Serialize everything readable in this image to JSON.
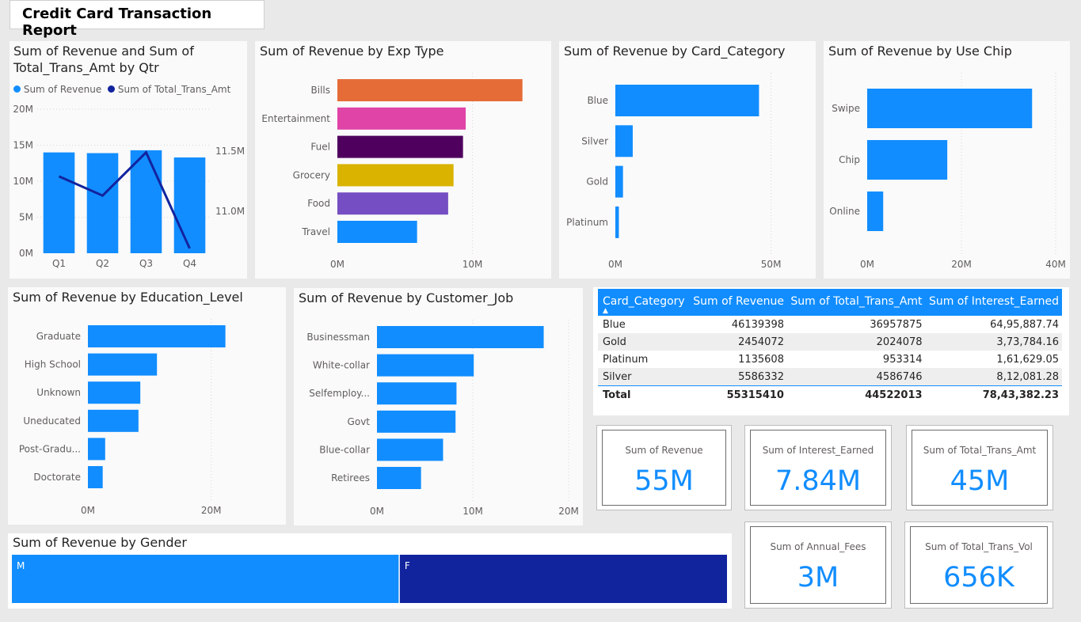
{
  "report": {
    "title": "Credit Card Transaction Report"
  },
  "colors": {
    "blue": "#118DFF",
    "navy": "#12239E",
    "orange": "#E66C37",
    "pink": "#E044A7",
    "purple": "#6B007B",
    "dark_purple": "#4F005E",
    "gold": "#D9B300",
    "violet": "#744EC2"
  },
  "qtr_chart": {
    "title_line1": "Sum of Revenue and Sum of",
    "title_line2": "Total_Trans_Amt by Qtr",
    "legend": [
      "Sum of Revenue",
      "Sum of Total_Trans_Amt"
    ]
  },
  "exp_chart": {
    "title": "Sum of Revenue by Exp Type"
  },
  "card_cat_chart": {
    "title": "Sum of Revenue by Card_Category"
  },
  "chip_chart": {
    "title": "Sum of Revenue by Use Chip"
  },
  "edu_chart": {
    "title": "Sum of Revenue by Education_Level"
  },
  "job_chart": {
    "title": "Sum of Revenue by Customer_Job"
  },
  "gender_chart": {
    "title": "Sum of Revenue by Gender"
  },
  "table": {
    "columns": [
      "Card_Category",
      "Sum of Revenue",
      "Sum of Total_Trans_Amt",
      "Sum of Interest_Earned"
    ],
    "rows": [
      [
        "Blue",
        "46139398",
        "36957875",
        "64,95,887.74"
      ],
      [
        "Gold",
        "2454072",
        "2024078",
        "3,73,784.16"
      ],
      [
        "Platinum",
        "1135608",
        "953314",
        "1,61,629.05"
      ],
      [
        "Silver",
        "5586332",
        "4586746",
        "8,12,081.28"
      ]
    ],
    "total": [
      "Total",
      "55315410",
      "44522013",
      "78,43,382.23"
    ]
  },
  "kpis": [
    {
      "label": "Sum of Revenue",
      "value": "55M"
    },
    {
      "label": "Sum of Interest_Earned",
      "value": "7.84M"
    },
    {
      "label": "Sum of Total_Trans_Amt",
      "value": "45M"
    },
    {
      "label": "Sum of Annual_Fees",
      "value": "3M"
    },
    {
      "label": "Sum of Total_Trans_Vol",
      "value": "656K"
    }
  ],
  "chart_data": [
    {
      "id": "qtr",
      "type": "bar",
      "title": "Sum of Revenue and Sum of Total_Trans_Amt by Qtr",
      "categories": [
        "Q1",
        "Q2",
        "Q3",
        "Q4"
      ],
      "series": [
        {
          "name": "Sum of Revenue",
          "type": "bar",
          "axis": "left",
          "values": [
            14000000,
            13900000,
            14300000,
            13300000
          ]
        },
        {
          "name": "Sum of Total_Trans_Amt",
          "type": "line",
          "axis": "right",
          "values": [
            11290000,
            11130000,
            11490000,
            10690000
          ]
        }
      ],
      "ylim": [
        0,
        20000000
      ],
      "yticks": [
        0,
        5000000,
        10000000,
        15000000,
        20000000
      ],
      "ytick_labels": [
        "0M",
        "5M",
        "10M",
        "15M",
        "20M"
      ],
      "y2lim": [
        10650000,
        11850000
      ],
      "y2ticks": [
        11000000,
        11500000
      ],
      "y2tick_labels": [
        "11.0M",
        "11.5M"
      ],
      "legend": "top-left"
    },
    {
      "id": "exp",
      "type": "bar",
      "orientation": "horizontal",
      "title": "Sum of Revenue by Exp Type",
      "categories": [
        "Bills",
        "Entertainment",
        "Fuel",
        "Grocery",
        "Food",
        "Travel"
      ],
      "values": [
        13700000,
        9500000,
        9300000,
        8600000,
        8200000,
        5900000
      ],
      "colors": [
        "#E66C37",
        "#E044A7",
        "#4F005E",
        "#D9B300",
        "#744EC2",
        "#118DFF"
      ],
      "xlim": [
        0,
        17000000
      ],
      "xticks": [
        0,
        10000000
      ],
      "xtick_labels": [
        "0M",
        "10M"
      ]
    },
    {
      "id": "cardcat",
      "type": "bar",
      "orientation": "horizontal",
      "title": "Sum of Revenue by Card_Category",
      "categories": [
        "Blue",
        "Silver",
        "Gold",
        "Platinum"
      ],
      "values": [
        46139398,
        5586332,
        2454072,
        1135608
      ],
      "xlim": [
        0,
        59000000
      ],
      "xticks": [
        0,
        50000000
      ],
      "xtick_labels": [
        "0M",
        "50M"
      ]
    },
    {
      "id": "chip",
      "type": "bar",
      "orientation": "horizontal",
      "title": "Sum of Revenue by Use Chip",
      "categories": [
        "Swipe",
        "Chip",
        "Online"
      ],
      "values": [
        35000000,
        17000000,
        3400000
      ],
      "xlim": [
        0,
        40000000
      ],
      "xticks": [
        0,
        20000000,
        40000000
      ],
      "xtick_labels": [
        "0M",
        "20M",
        "40M"
      ]
    },
    {
      "id": "edu",
      "type": "bar",
      "orientation": "horizontal",
      "title": "Sum of Revenue by Education_Level",
      "categories": [
        "Graduate",
        "High School",
        "Unknown",
        "Uneducated",
        "Post-Gradu...",
        "Doctorate"
      ],
      "values": [
        22300000,
        11200000,
        8500000,
        8200000,
        2800000,
        2400000
      ],
      "xlim": [
        0,
        28000000
      ],
      "xticks": [
        0,
        20000000
      ],
      "xtick_labels": [
        "0M",
        "20M"
      ]
    },
    {
      "id": "job",
      "type": "bar",
      "orientation": "horizontal",
      "title": "Sum of Revenue by Customer_Job",
      "categories": [
        "Businessman",
        "White-collar",
        "Selfemploy...",
        "Govt",
        "Blue-collar",
        "Retirees"
      ],
      "values": [
        17400000,
        10100000,
        8300000,
        8200000,
        6900000,
        4600000
      ],
      "xlim": [
        0,
        20000000
      ],
      "xticks": [
        0,
        10000000,
        20000000
      ],
      "xtick_labels": [
        "0M",
        "10M",
        "20M"
      ]
    },
    {
      "id": "gender",
      "type": "bar",
      "orientation": "stacked-100",
      "title": "Sum of Revenue by Gender",
      "categories": [
        "M",
        "F"
      ],
      "values": [
        30000000,
        25300000
      ],
      "colors": [
        "#118DFF",
        "#12239E"
      ]
    }
  ]
}
